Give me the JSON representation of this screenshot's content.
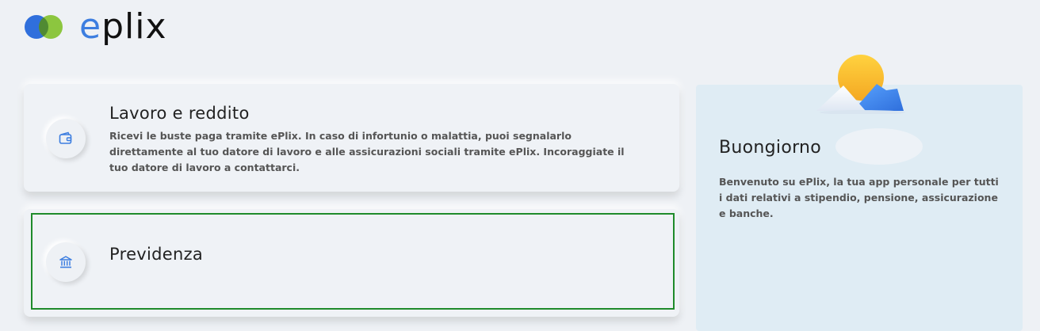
{
  "app": {
    "logo_text": "eplix",
    "logo_accent_letter": "e",
    "logo_rest": "plix"
  },
  "cards": [
    {
      "title": "Lavoro e reddito",
      "description": "Ricevi le buste paga tramite ePlix. In caso di infortunio o malattia, puoi segnalarlo direttamente al tuo datore di lavoro e alle assicurazioni sociali tramite ePlix. Incoraggiate il tuo datore di lavoro a contattarci.",
      "icon": "wallet-icon"
    },
    {
      "title": "Previdenza",
      "icon": "bank-icon"
    }
  ],
  "greeting": {
    "title": "Buongiorno",
    "text": "Benvenuto su ePlix, la tua app personale per tutti i dati relativi a stipendio, pensione, assicurazione e banche.",
    "icon": "weather-sun-mountain-icon"
  },
  "colors": {
    "background": "#eef1f5",
    "brand_blue": "#3d7ee0",
    "brand_green": "#8cc63f",
    "panel": "#dfecf4",
    "focus_border": "#1f8b2b"
  }
}
